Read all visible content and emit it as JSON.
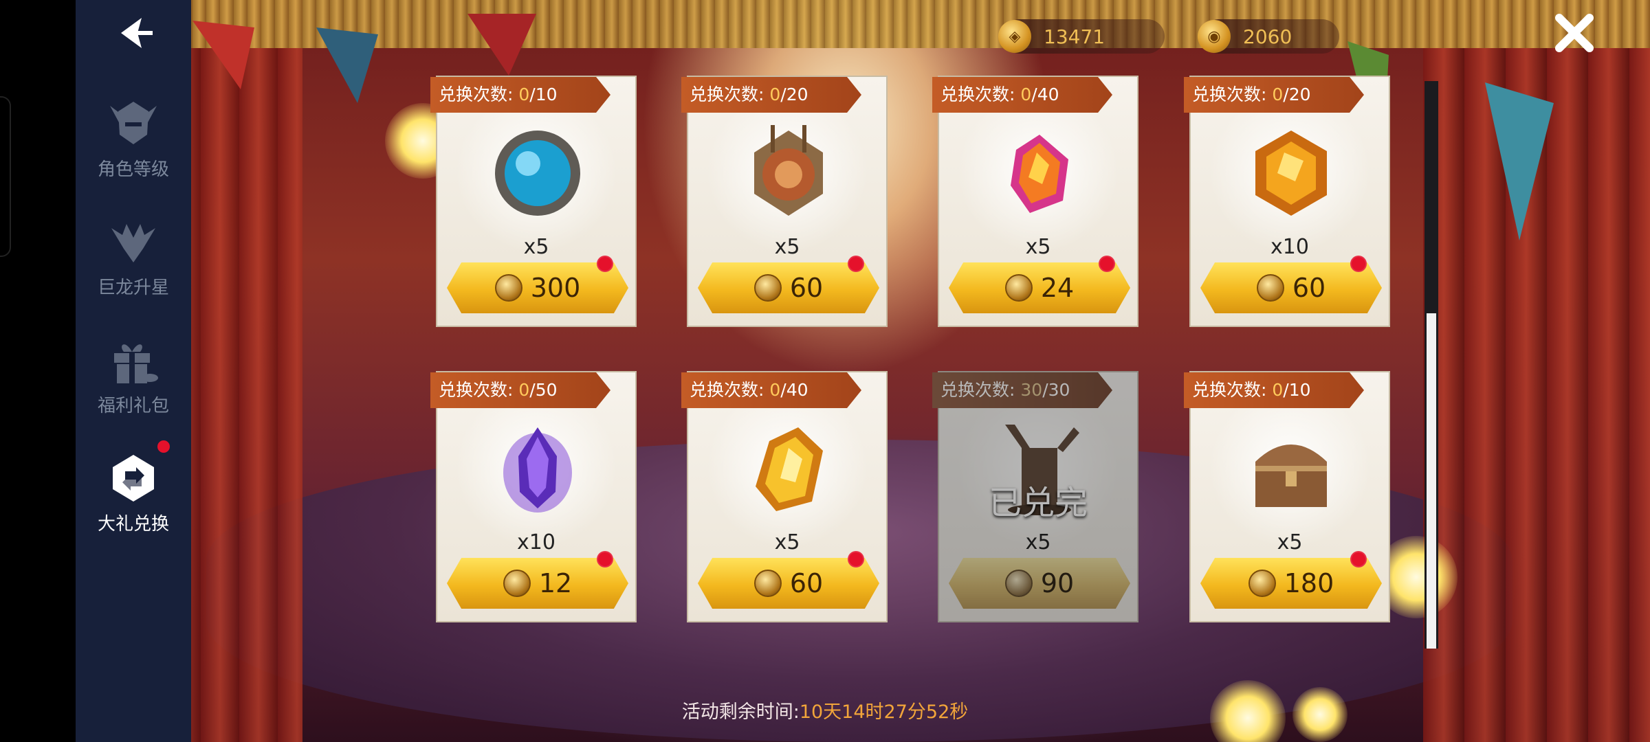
{
  "nav": {
    "back_icon": "back-arrow-icon",
    "items": [
      {
        "label": "角色等级",
        "icon": "helmet-icon",
        "active": false
      },
      {
        "label": "巨龙升星",
        "icon": "dragon-icon",
        "active": false
      },
      {
        "label": "福利礼包",
        "icon": "gift-icon",
        "active": false
      },
      {
        "label": "大礼兑换",
        "icon": "exchange-icon",
        "active": true,
        "badge": true
      }
    ]
  },
  "currencies": [
    {
      "icon": "gold-token-icon",
      "value": "13471"
    },
    {
      "icon": "dragon-coin-icon",
      "value": "2060"
    }
  ],
  "close_icon": "close-x-icon",
  "cards": [
    {
      "tag_prefix": "兑换次数: ",
      "used": "0",
      "limit": "/10",
      "item": "blue-orb-gem",
      "qty": "x5",
      "price": "300",
      "dot": true,
      "done": false
    },
    {
      "tag_prefix": "兑换次数: ",
      "used": "0",
      "limit": "/20",
      "item": "bronze-medal",
      "qty": "x5",
      "price": "60",
      "dot": true,
      "done": false
    },
    {
      "tag_prefix": "兑换次数: ",
      "used": "0",
      "limit": "/40",
      "item": "fire-crystal",
      "qty": "x5",
      "price": "24",
      "dot": true,
      "done": false
    },
    {
      "tag_prefix": "兑换次数: ",
      "used": "0",
      "limit": "/20",
      "item": "amber-gem",
      "qty": "x10",
      "price": "60",
      "dot": true,
      "done": false
    },
    {
      "tag_prefix": "兑换次数: ",
      "used": "0",
      "limit": "/50",
      "item": "purple-crystal",
      "qty": "x10",
      "price": "12",
      "dot": true,
      "done": false
    },
    {
      "tag_prefix": "兑换次数: ",
      "used": "0",
      "limit": "/40",
      "item": "gold-crystal",
      "qty": "x5",
      "price": "60",
      "dot": true,
      "done": false
    },
    {
      "tag_prefix": "兑换次数: ",
      "used": "30",
      "limit": "/30",
      "item": "tree-stump",
      "qty": "x5",
      "price": "90",
      "dot": false,
      "done": true,
      "done_label": "已兑完"
    },
    {
      "tag_prefix": "兑换次数: ",
      "used": "0",
      "limit": "/10",
      "item": "treasure-chest",
      "qty": "x5",
      "price": "180",
      "dot": true,
      "done": false
    }
  ],
  "timer": {
    "label": "活动剩余时间:",
    "value": "10天14时27分52秒"
  },
  "colors": {
    "sidebar": "#17203a",
    "accent_gold": "#f2a53a",
    "badge_red": "#e5112b"
  }
}
